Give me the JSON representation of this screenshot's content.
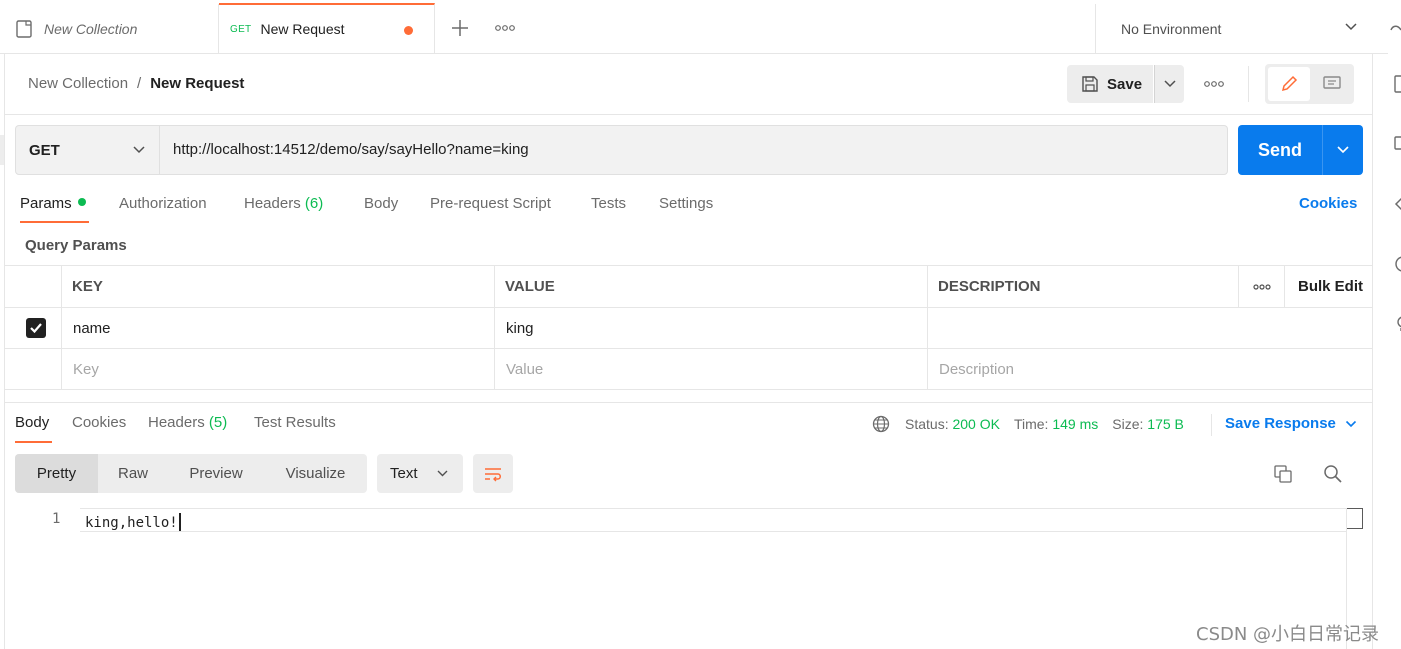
{
  "tabs": {
    "collection_tab": {
      "title": "New Collection"
    },
    "request_tab": {
      "method": "GET",
      "title": "New Request"
    }
  },
  "environment": {
    "selected": "No Environment"
  },
  "breadcrumb": {
    "collection": "New Collection",
    "separator": "/",
    "request": "New Request"
  },
  "toolbar": {
    "save_label": "Save"
  },
  "request": {
    "method": "GET",
    "url": "http://localhost:14512/demo/say/sayHello?name=king",
    "send_label": "Send"
  },
  "request_tabs": [
    {
      "label": "Params"
    },
    {
      "label": "Authorization"
    },
    {
      "label": "Headers",
      "count": "(6)"
    },
    {
      "label": "Body"
    },
    {
      "label": "Pre-request Script"
    },
    {
      "label": "Tests"
    },
    {
      "label": "Settings"
    }
  ],
  "cookies_label": "Cookies",
  "query_params": {
    "title": "Query Params",
    "headers": {
      "key": "KEY",
      "value": "VALUE",
      "description": "DESCRIPTION",
      "bulk_edit": "Bulk Edit"
    },
    "rows": [
      {
        "key": "name",
        "value": "king",
        "description": "",
        "checked": true
      }
    ],
    "placeholders": {
      "key": "Key",
      "value": "Value",
      "description": "Description"
    }
  },
  "response": {
    "tabs": [
      {
        "label": "Body"
      },
      {
        "label": "Cookies"
      },
      {
        "label": "Headers",
        "count": "(5)"
      },
      {
        "label": "Test Results"
      }
    ],
    "status_label": "Status:",
    "status_value": "200 OK",
    "time_label": "Time:",
    "time_value": "149 ms",
    "size_label": "Size:",
    "size_value": "175 B",
    "save_response_label": "Save Response",
    "view_modes": [
      "Pretty",
      "Raw",
      "Preview",
      "Visualize"
    ],
    "language": "Text",
    "body_lines": [
      {
        "number": "1",
        "text": "king,hello!"
      }
    ]
  },
  "colors": {
    "accent": "#ff6c37",
    "send": "#097bed",
    "success": "#0cbb52",
    "link": "#097bed"
  },
  "watermark": "CSDN @小白日常记录"
}
